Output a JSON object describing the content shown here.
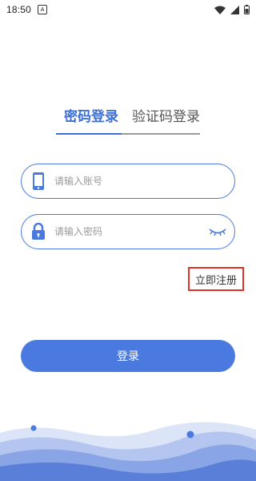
{
  "status_bar": {
    "time": "18:50",
    "app_icon": "A",
    "icons": [
      "wifi-icon",
      "signal-icon",
      "battery-icon"
    ]
  },
  "tabs": [
    {
      "label": "密码登录",
      "active": true
    },
    {
      "label": "验证码登录",
      "active": false
    }
  ],
  "account_field": {
    "placeholder": "请输入账号",
    "icon": "phone-icon"
  },
  "password_field": {
    "placeholder": "请输入密码",
    "icon": "lock-icon",
    "toggle_icon": "eye-closed-icon"
  },
  "register_link": {
    "label": "立即注册"
  },
  "login_button": {
    "label": "登录"
  },
  "colors": {
    "accent": "#4a7ae0",
    "active_tab": "#3d6fd6",
    "highlight_border": "#e0302a",
    "wave_light": "#c9d6f3",
    "wave_mid": "#92aae6",
    "wave_dark": "#5a7fd8"
  }
}
